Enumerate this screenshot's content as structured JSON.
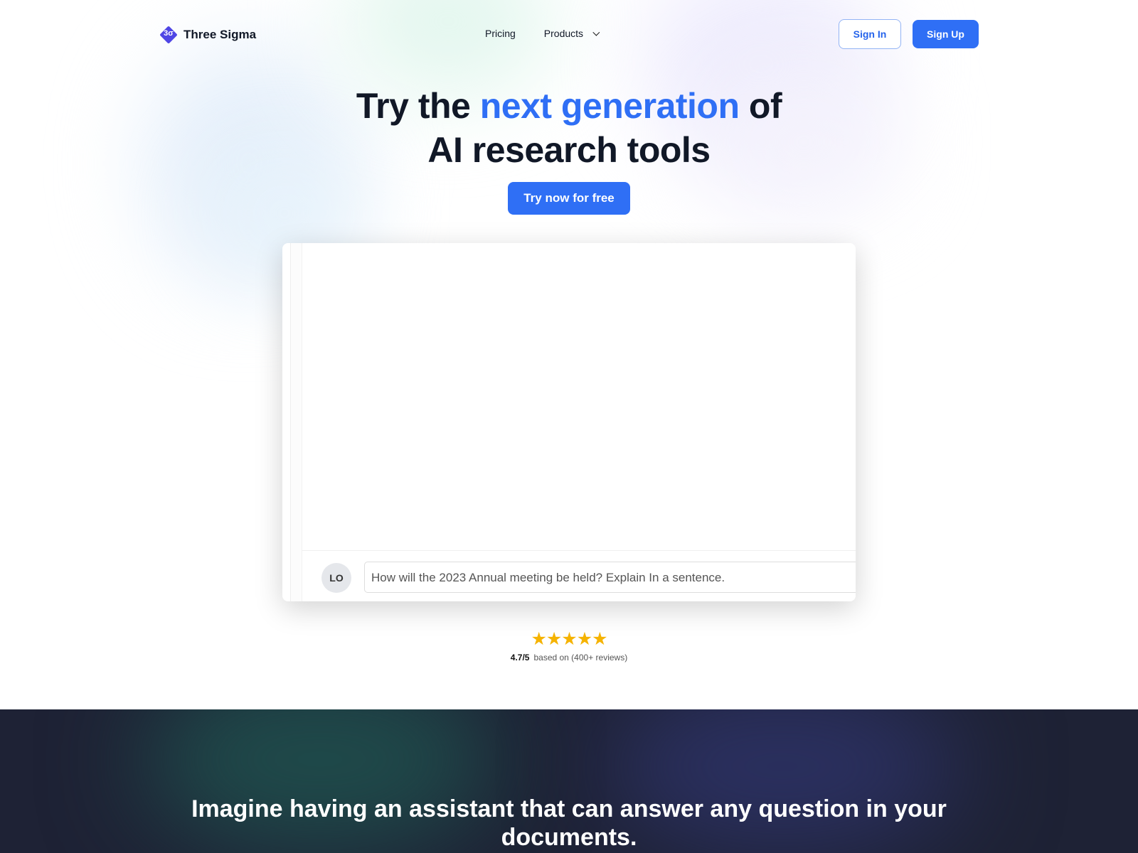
{
  "nav": {
    "logo_mark": "3σ",
    "brand": "Three Sigma",
    "links": [
      "Pricing",
      "Products"
    ],
    "sign_in": "Sign In",
    "sign_up": "Sign Up"
  },
  "hero": {
    "title_pre": "Try the ",
    "title_highlight": "next generation",
    "title_post": " of",
    "title_line2": "AI research tools",
    "cta": "Try now for free"
  },
  "demo": {
    "avatar": "LO",
    "query": "How will the 2023 Annual meeting be held? Explain In a sentence."
  },
  "rating": {
    "stars": "★★★★★",
    "score": "4.7/5",
    "text": "based on (400+ reviews)",
    "value": 4.7
  },
  "section2": {
    "heading": "Imagine having an assistant that can answer any question in your documents."
  },
  "colors": {
    "accent": "#2f6ff5",
    "logo": "#4f46e5",
    "star": "#f5b301",
    "dark_bg": "#1e2235"
  }
}
